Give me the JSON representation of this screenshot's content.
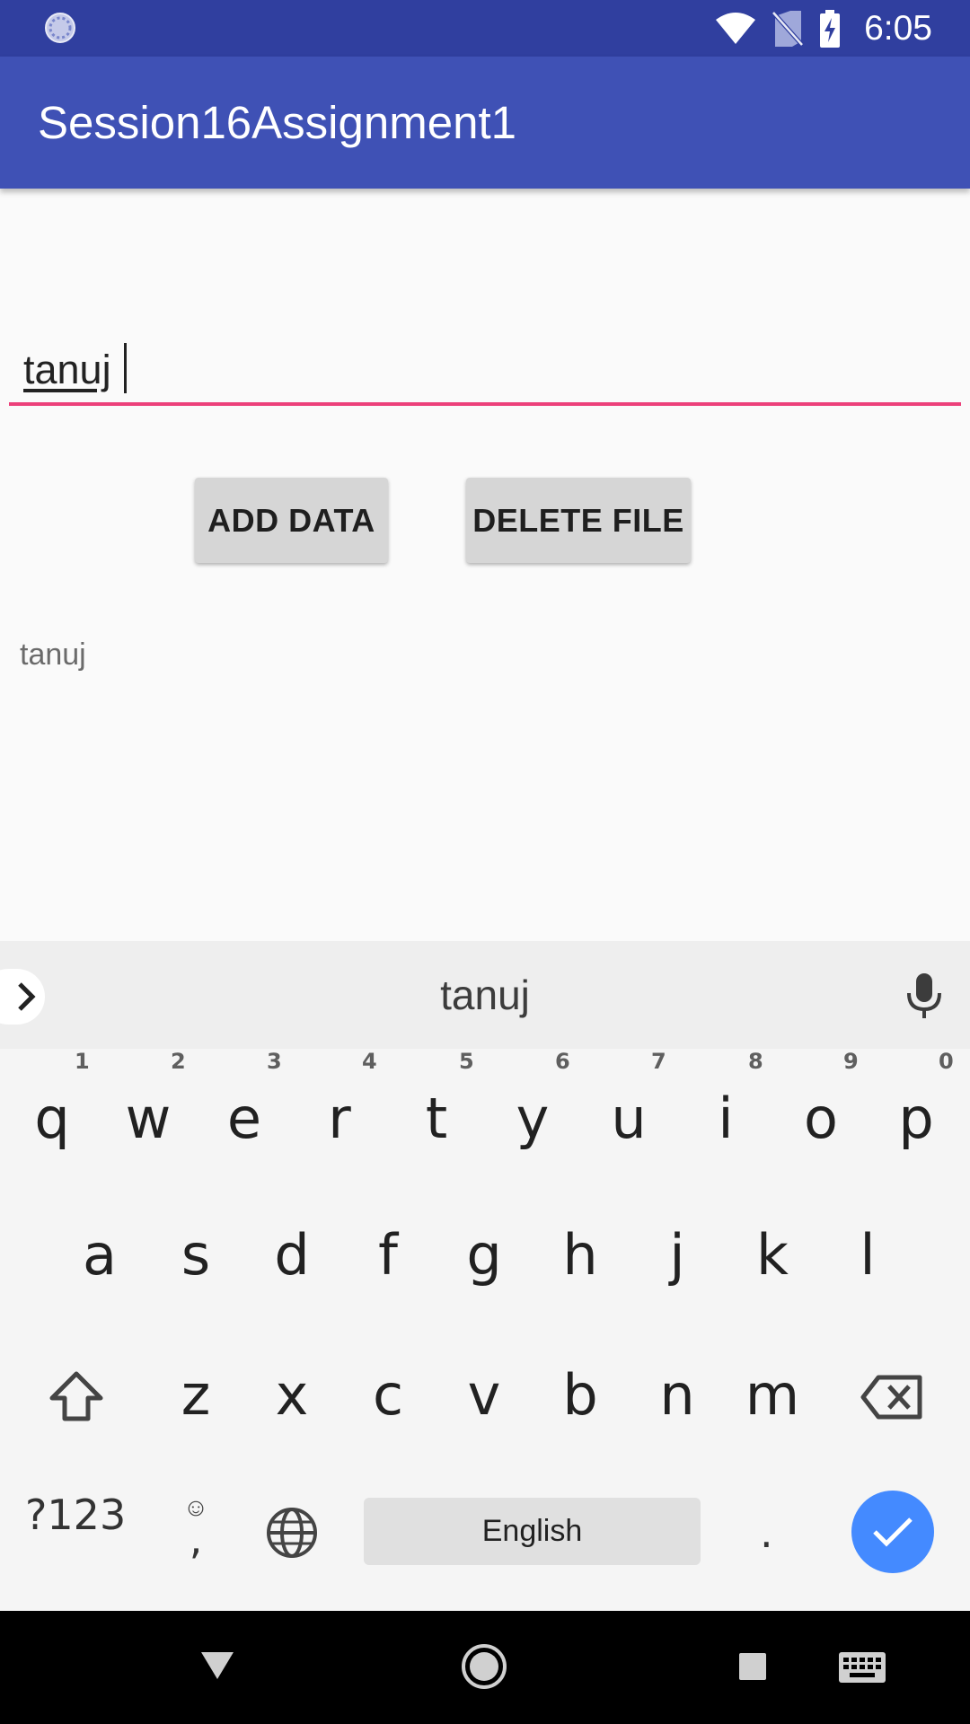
{
  "status_bar": {
    "time": "6:05"
  },
  "app_bar": {
    "title": "Session16Assignment1"
  },
  "edit_text": {
    "value": "tanuj"
  },
  "buttons": {
    "add_data": "ADD DATA",
    "delete_file": "DELETE FILE"
  },
  "result_text": "tanuj",
  "keyboard": {
    "suggestion": "tanuj",
    "row1": [
      {
        "key": "q",
        "hint": "1"
      },
      {
        "key": "w",
        "hint": "2"
      },
      {
        "key": "e",
        "hint": "3"
      },
      {
        "key": "r",
        "hint": "4"
      },
      {
        "key": "t",
        "hint": "5"
      },
      {
        "key": "y",
        "hint": "6"
      },
      {
        "key": "u",
        "hint": "7"
      },
      {
        "key": "i",
        "hint": "8"
      },
      {
        "key": "o",
        "hint": "9"
      },
      {
        "key": "p",
        "hint": "0"
      }
    ],
    "row2": [
      "a",
      "s",
      "d",
      "f",
      "g",
      "h",
      "j",
      "k",
      "l"
    ],
    "row3": [
      "z",
      "x",
      "c",
      "v",
      "b",
      "n",
      "m"
    ],
    "symbols_label": "?123",
    "comma_label": ",",
    "period_label": ".",
    "space_label": "English"
  },
  "colors": {
    "status_bar": "#303f9f",
    "app_bar": "#3f51b5",
    "accent_underline": "#ec407a",
    "enter_key": "#448aff"
  }
}
